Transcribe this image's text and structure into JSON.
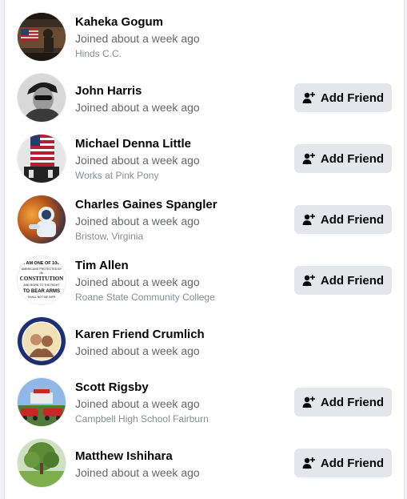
{
  "people": [
    {
      "name": "Kaheka Gogum",
      "joined": "Joined about a week ago",
      "detail": "Hinds C.C.",
      "avatar": "flag-poster-avatar",
      "has_button": false
    },
    {
      "name": "John Harris",
      "joined": "Joined about a week ago",
      "detail": "",
      "avatar": "man-sunglasses-avatar",
      "has_button": true
    },
    {
      "name": "Michael Denna Little",
      "joined": "Joined about a week ago",
      "detail": "Works at Pink Pony",
      "avatar": "flag-poster-avatar",
      "has_button": true
    },
    {
      "name": "Charles Gaines Spangler",
      "joined": "Joined about a week ago",
      "detail": "Bristow, Virginia",
      "avatar": "astronaut-avatar",
      "has_button": true
    },
    {
      "name": "Tim Allen",
      "joined": "Joined about a week ago",
      "detail": "Roane State Community College",
      "avatar": "constitution-text-avatar",
      "has_button": true
    },
    {
      "name": "Karen Friend Crumlich",
      "joined": "Joined about a week ago",
      "detail": "",
      "avatar": "framed-portrait-avatar",
      "has_button": false
    },
    {
      "name": "Scott Rigsby",
      "joined": "Joined about a week ago",
      "detail": "Campbell High School Fairburn",
      "avatar": "red-cars-avatar",
      "has_button": true
    },
    {
      "name": "Matthew Ishihara",
      "joined": "Joined about a week ago",
      "detail": "",
      "avatar": "tree-landscape-avatar",
      "has_button": true
    }
  ],
  "add_friend_label": "Add Friend",
  "add_friend_icon": "person-plus-icon",
  "avatar_text": {
    "constitution_lines": [
      "I AM ONE OF 100",
      "AMERICANS PROTECTED BY",
      "the",
      "CONSTITUTION",
      "AND BORN TO THE RIGHT",
      "TO BEAR ARMS",
      "SHALL NOT BE INFR"
    ]
  }
}
